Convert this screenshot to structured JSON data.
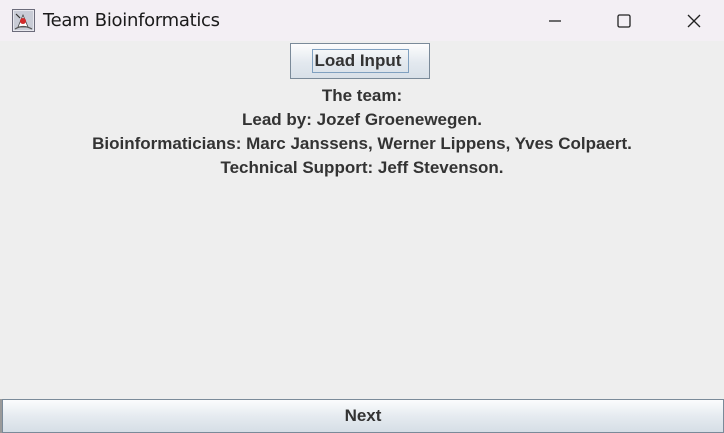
{
  "window": {
    "title": "Team Bioinformatics",
    "icons": {
      "app": "java-app-icon",
      "minimize": "minimize-icon",
      "maximize": "maximize-icon",
      "close": "close-icon"
    }
  },
  "main": {
    "load_button_label": "Load Input",
    "team_heading": "The team:",
    "lead": "Lead by: Jozef Groenewegen.",
    "bioinformaticians": "Bioinformaticians: Marc Janssens, Werner Lippens, Yves Colpaert.",
    "support": "Technical Support: Jeff Stevenson."
  },
  "footer": {
    "next_button_label": "Next"
  }
}
